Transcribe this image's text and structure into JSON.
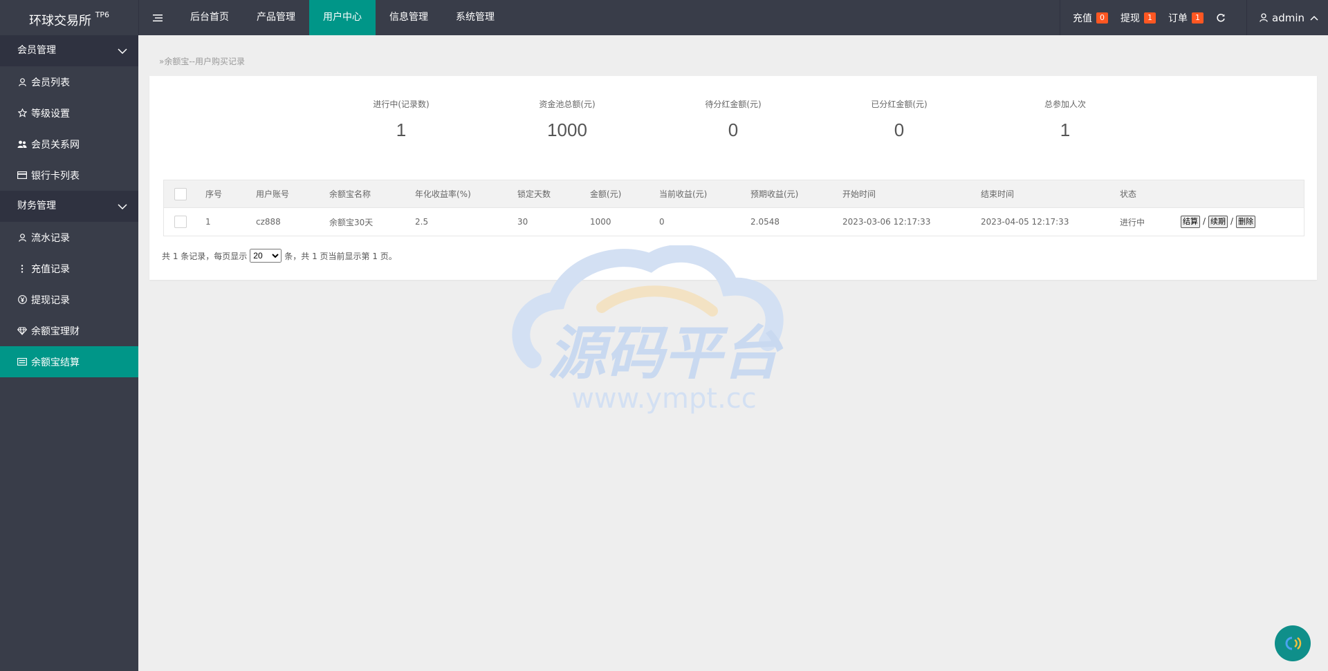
{
  "header": {
    "logo_text": "环球交易所",
    "logo_sup": "TP6",
    "nav": [
      "后台首页",
      "产品管理",
      "用户中心",
      "信息管理",
      "系统管理"
    ],
    "active_nav": "用户中心",
    "stats": [
      {
        "label": "充值",
        "count": "0"
      },
      {
        "label": "提现",
        "count": "1"
      },
      {
        "label": "订单",
        "count": "1"
      }
    ],
    "user": "admin"
  },
  "sidebar": {
    "groups": [
      {
        "title": "会员管理",
        "items": [
          {
            "label": "会员列表",
            "icon": "user-icon"
          },
          {
            "label": "等级设置",
            "icon": "star-icon"
          },
          {
            "label": "会员关系网",
            "icon": "users-icon"
          },
          {
            "label": "银行卡列表",
            "icon": "card-icon"
          }
        ]
      },
      {
        "title": "财务管理",
        "items": [
          {
            "label": "流水记录",
            "icon": "user-icon"
          },
          {
            "label": "充值记录",
            "icon": "more-vertical-icon"
          },
          {
            "label": "提现记录",
            "icon": "yen-icon"
          },
          {
            "label": "余额宝理财",
            "icon": "diamond-icon"
          },
          {
            "label": "余额宝结算",
            "icon": "list-icon"
          }
        ]
      }
    ],
    "active_item": "余额宝结算"
  },
  "breadcrumb": "余额宝--用户购买记录",
  "summary": [
    {
      "label": "进行中(记录数)",
      "value": "1"
    },
    {
      "label": "资金池总额(元)",
      "value": "1000"
    },
    {
      "label": "待分红金额(元)",
      "value": "0"
    },
    {
      "label": "已分红金额(元)",
      "value": "0"
    },
    {
      "label": "总参加人次",
      "value": "1"
    }
  ],
  "table": {
    "columns": [
      "序号",
      "用户账号",
      "余额宝名称",
      "年化收益率(%)",
      "锁定天数",
      "金额(元)",
      "当前收益(元)",
      "预期收益(元)",
      "开始时间",
      "结束时间",
      "状态"
    ],
    "rows": [
      [
        "1",
        "cz888",
        "余额宝30天",
        "2.5",
        "30",
        "1000",
        "0",
        "2.0548",
        "2023-03-06 12:17:33",
        "2023-04-05 12:17:33",
        "进行中"
      ]
    ],
    "actions": [
      "结算",
      "续期",
      "删除"
    ]
  },
  "pager": {
    "prefix": "共 1 条记录，每页显示",
    "page_size": "20",
    "suffix": "条，共 1 页当前显示第 1 页。"
  },
  "watermark": {
    "title": "源码平台",
    "url": "www.ympt.cc"
  }
}
